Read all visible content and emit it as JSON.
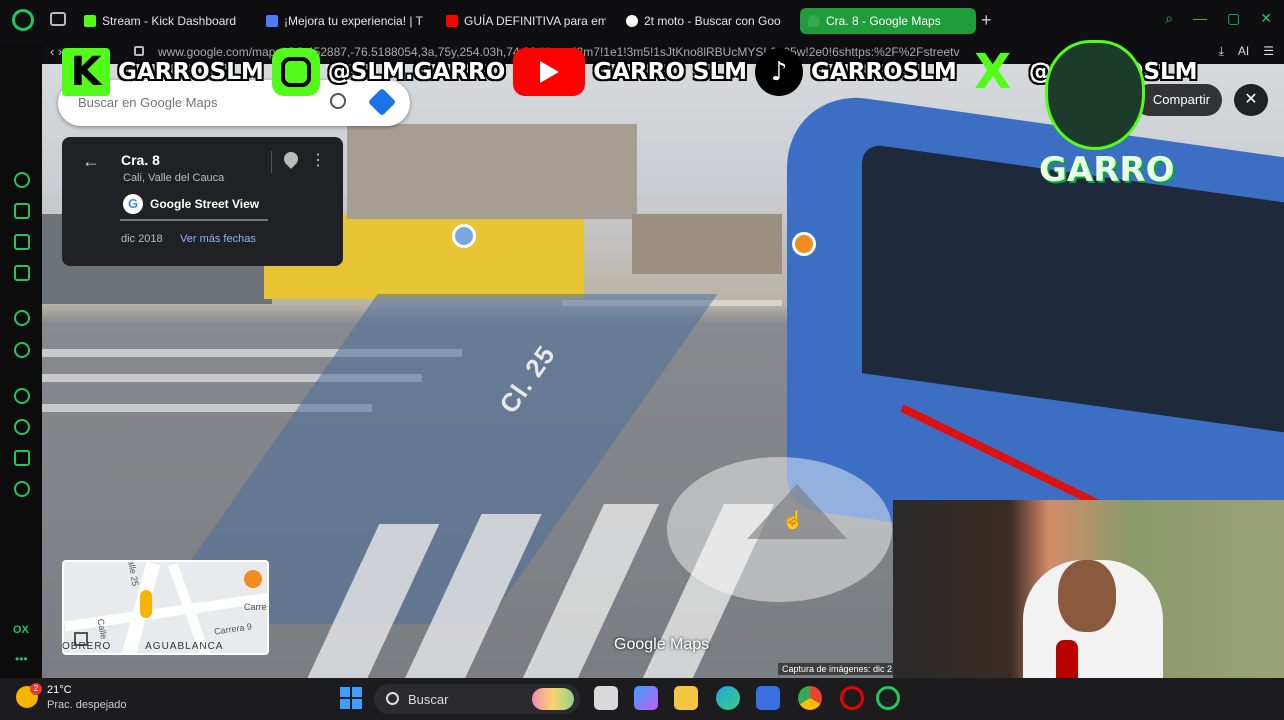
{
  "browser": {
    "tabs": [
      {
        "title": "Stream - Kick Dashboard",
        "favicon": "kick-icon",
        "color": "#53fc18",
        "active": false
      },
      {
        "title": "¡Mejora tu experiencia! | T",
        "favicon": "sparkle-icon",
        "color": "#4c7dff",
        "active": false
      },
      {
        "title": "GUÍA DEFINITIVA para em",
        "favicon": "youtube-icon",
        "color": "#ff0000",
        "active": false
      },
      {
        "title": "2t moto - Buscar con Goo",
        "favicon": "google-icon",
        "color": "#ffffff",
        "active": false
      },
      {
        "title": "Cra. 8 - Google Maps",
        "favicon": "maps-icon",
        "color": "#34a853",
        "active": true
      }
    ],
    "new_tab": "+",
    "url": "www.google.com/maps/@3.452887,-76.5188054,3a,75y,254.03h,74.06t/data=!3m7!1e1!3m5!1sJtKno8lRBUcMYSL6n95w!2e0!6shttps:%2F%2Fstreetv",
    "ai_label": "AI",
    "accent": "#22c55e"
  },
  "maps": {
    "search_placeholder": "Buscar en Google Maps",
    "place_title": "Cra. 8",
    "place_subtitle": "Cali, Valle del Cauca",
    "street_view_label": "Google Street View",
    "capture_date": "dic 2018",
    "more_dates": "Ver más fechas",
    "share_label": "Compartir",
    "street_label": "Cl. 25",
    "watermark": "Google Maps",
    "image_credit": "Captura de imágenes: dic 2",
    "minimap": {
      "labels": [
        "alle 25",
        "Carre",
        "Carrera 9",
        "Calle",
        "AGUABLANCA",
        "OBRERO"
      ]
    }
  },
  "overlay": {
    "socials": [
      {
        "platform": "kick",
        "handle": "GARROSLM"
      },
      {
        "platform": "instagram",
        "handle": "@SLM.GARRO"
      },
      {
        "platform": "youtube",
        "handle": "GARRO SLM"
      },
      {
        "platform": "tiktok",
        "handle": "GARROSLM"
      },
      {
        "platform": "x",
        "handle": "@GARROSLM"
      }
    ],
    "brand": "GARRO",
    "brand_color": "#53fc18"
  },
  "taskbar": {
    "weather_temp": "21°C",
    "weather_desc": "Prac. despejado",
    "weather_badge": "2",
    "search_placeholder": "Buscar"
  }
}
